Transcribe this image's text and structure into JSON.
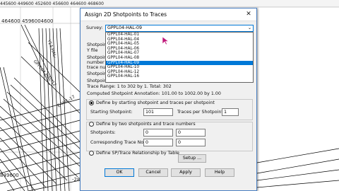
{
  "map": {
    "top_ruler": "445600 449600 452600 456600 464600 468600",
    "axis_label_top": "464600 4596004600",
    "axis_label_side1": "Y14-HAL-",
    "axis_label_side2": "E-HAL-17",
    "axis_label_side3": "GPPL04-HAL-12",
    "axis_label_bottom": "-2849500",
    "axis_label_bottom2": "849600"
  },
  "dialog": {
    "title": "Assign 2D Shotpoints to Traces",
    "survey_label": "Survey:",
    "survey_value": "GPPL04-HAL-09",
    "survey_options": [
      "GPPL04-HAL-01",
      "GPPL04-HAL-04",
      "GPPL04-HAL-05",
      "GPPL04-HAL-06",
      "GPPL04-HAL-07",
      "GPPL04-HAL-08",
      "GPPL04-HAL-09",
      "GPPL04-HAL-10",
      "GPPL04-HAL-12",
      "GPPL04-HAL-16"
    ],
    "selected_index": 6,
    "hidden_labels": [
      "Shotpoin",
      "Y file",
      "Shotpoin",
      "number o",
      "trace nur",
      "Shotpoin",
      "Shotpoin"
    ],
    "trace_range": "Trace Range: 1 to 302 by 1. Total: 302",
    "computed_annotation": "Computed Shotpoint Annotation: 101.00 to 1002.00 by 1.00",
    "option1_label": "Define by starting shotpoint and traces per shotpoint",
    "starting_shotpoint_label": "Starting Shotpoint:",
    "starting_shotpoint_value": "101",
    "traces_per_shotpoint_label": "Traces per Shotpoint:",
    "traces_per_shotpoint_value": "1",
    "option2_label": "Define by two shotpoints and trace numbers",
    "shotpoints_label": "Shotpoints:",
    "shotpoint_a": "0",
    "shotpoint_b": "0",
    "corr_trace_label": "Corresponding Trace No:",
    "trace_a": "0",
    "trace_b": "0",
    "option3_label": "Define SP/Trace Relationship by Table",
    "setup_label": "Setup ...",
    "ok_label": "OK",
    "cancel_label": "Cancel",
    "apply_label": "Apply",
    "help_label": "Help"
  },
  "colors": {
    "accent": "#0078d7",
    "cursor": "#c0187a"
  }
}
